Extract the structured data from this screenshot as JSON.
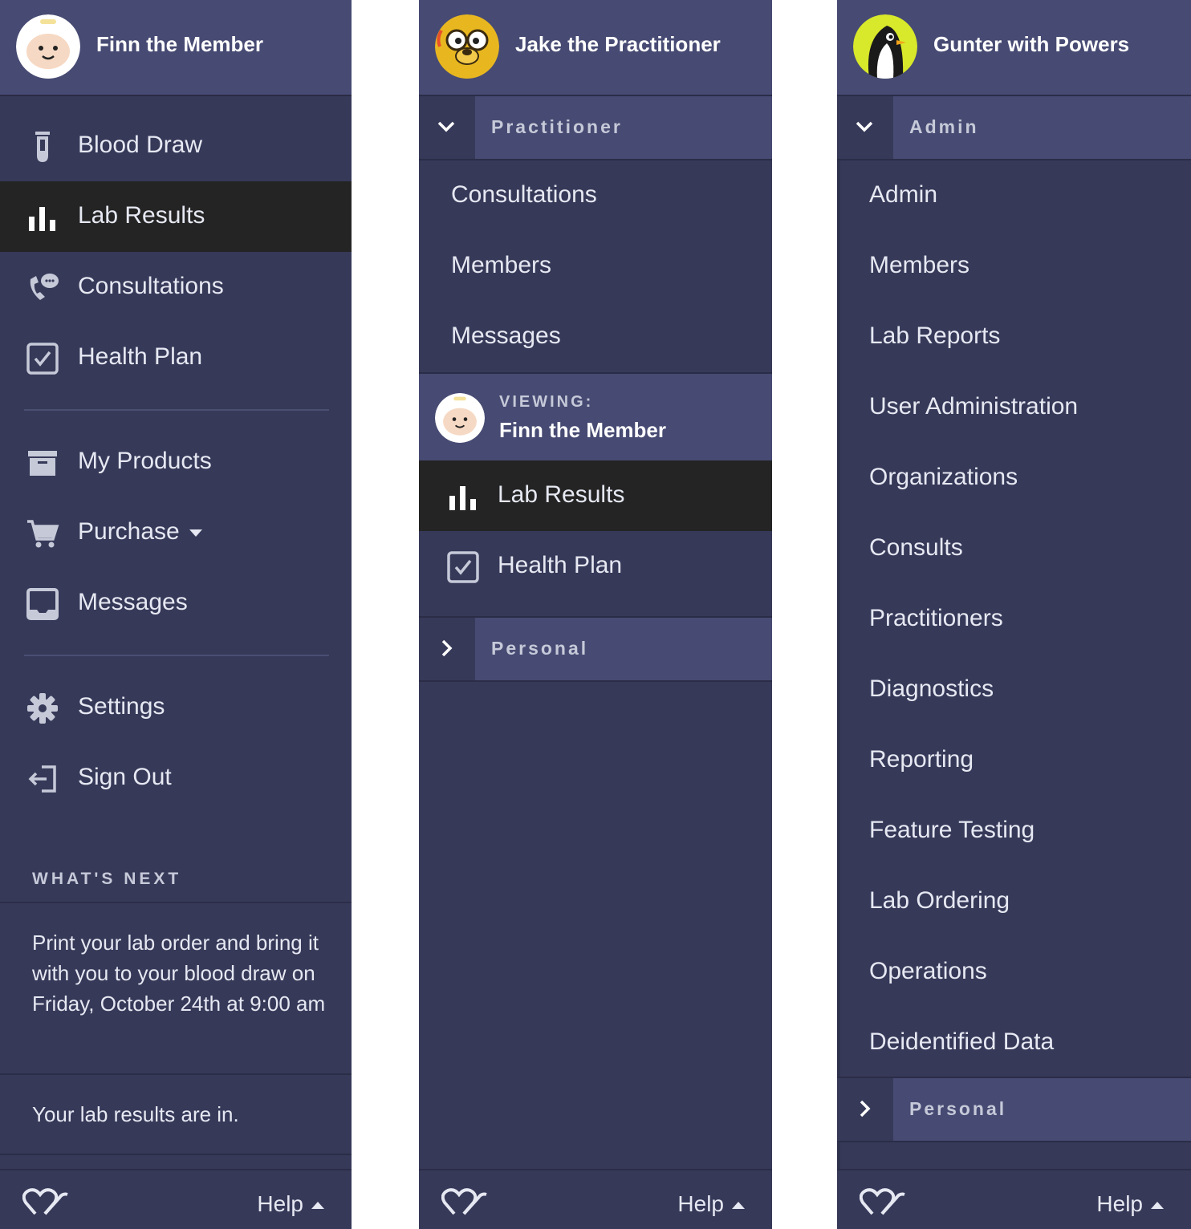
{
  "member_panel": {
    "user_name": "Finn the Member",
    "nav": [
      {
        "label": "Blood Draw",
        "icon": "test-tube-icon"
      },
      {
        "label": "Lab Results",
        "icon": "bar-chart-icon",
        "active": true
      },
      {
        "label": "Consultations",
        "icon": "phone-chat-icon"
      },
      {
        "label": "Health Plan",
        "icon": "checkbox-icon"
      }
    ],
    "nav2": [
      {
        "label": "My Products",
        "icon": "archive-box-icon"
      },
      {
        "label": "Purchase",
        "icon": "cart-icon"
      },
      {
        "label": "Messages",
        "icon": "inbox-icon"
      }
    ],
    "nav3": [
      {
        "label": "Settings",
        "icon": "gear-icon"
      },
      {
        "label": "Sign Out",
        "icon": "sign-out-icon"
      }
    ],
    "whats_next_label": "WHAT'S NEXT",
    "whats_next_items": [
      "Print your lab order and bring it with you to your blood draw on Friday, October 24th at 9:00 am",
      "Your lab results are in."
    ],
    "help_label": "Help"
  },
  "practitioner_panel": {
    "user_name": "Jake the Practitioner",
    "group_title": "Practitioner",
    "group_items": [
      "Consultations",
      "Members",
      "Messages"
    ],
    "viewing_label": "VIEWING:",
    "viewing_name": "Finn the Member",
    "viewing_nav": [
      {
        "label": "Lab Results",
        "icon": "bar-chart-icon",
        "active": true
      },
      {
        "label": "Health Plan",
        "icon": "checkbox-icon"
      }
    ],
    "personal_title": "Personal",
    "help_label": "Help"
  },
  "admin_panel": {
    "user_name": "Gunter with Powers",
    "group_title": "Admin",
    "group_items": [
      "Admin",
      "Members",
      "Lab Reports",
      "User Administration",
      "Organizations",
      "Consults",
      "Practitioners",
      "Diagnostics",
      "Reporting",
      "Feature Testing",
      "Lab Ordering",
      "Operations",
      "Deidentified Data"
    ],
    "personal_title": "Personal",
    "help_label": "Help"
  },
  "colors": {
    "panel_bg": "#363958",
    "header_bg": "#474b73",
    "active_bg": "#242424",
    "text": "#e6e8f2"
  }
}
